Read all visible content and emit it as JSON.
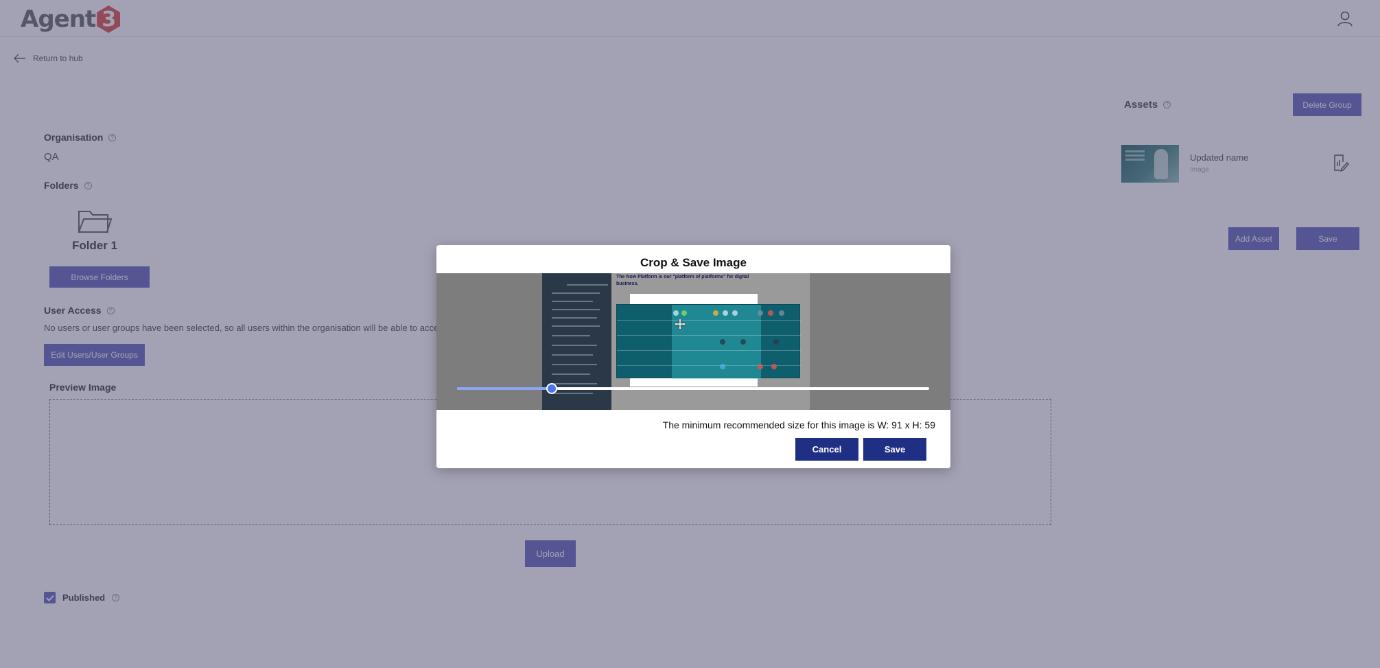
{
  "header": {
    "logo_text": "Agent",
    "logo_badge": "3",
    "user_icon": "user-icon"
  },
  "nav": {
    "back_label": "Return to hub",
    "back_icon": "arrow-left-icon"
  },
  "form": {
    "organisation_label": "Organisation",
    "organisation_value": "QA",
    "folders_label": "Folders",
    "folder_name": "Folder 1",
    "browse_folders_label": "Browse Folders",
    "user_access_label": "User Access",
    "user_access_text": "No users or user groups have been selected, so all users within the organisation will be able to access",
    "edit_users_label": "Edit Users/User Groups",
    "preview_image_label": "Preview Image",
    "upload_label": "Upload",
    "published_label": "Published",
    "published_checked": true
  },
  "assets": {
    "title": "Assets",
    "delete_group_label": "Delete Group",
    "items": [
      {
        "name": "Updated name",
        "type": "Image"
      }
    ],
    "add_asset_label": "Add Asset",
    "save_label": "Save"
  },
  "modal": {
    "title": "Crop & Save Image",
    "image_heading": "The Now Platform is our \"platform of platforms\" for digital",
    "image_heading2": "business.",
    "zoom_value": 0.2,
    "min_size_text": "The minimum recommended size for this image is W: 91 x H: 59",
    "cancel_label": "Cancel",
    "save_label": "Save"
  },
  "colors": {
    "accent_purple": "#6a6cc2",
    "modal_button": "#1f2f84",
    "slider_knob": "#4f76e8",
    "overlay": "rgba(62,60,98,0.48)"
  }
}
